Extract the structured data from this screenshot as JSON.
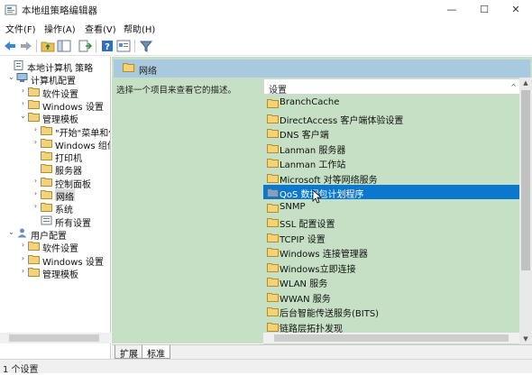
{
  "window": {
    "title": "本地组策略编辑器",
    "controls": {
      "minimize": "—",
      "maximize": "☐",
      "close": "✕"
    }
  },
  "menu": [
    "文件(F)",
    "操作(A)",
    "查看(V)",
    "帮助(H)"
  ],
  "toolbar": {
    "icons": [
      "back-arrow-icon",
      "forward-arrow-icon",
      "up-folder-icon",
      "show-hide-tree-icon",
      "export-list-icon",
      "help-icon",
      "properties-icon",
      "filter-icon"
    ]
  },
  "tree": {
    "items": [
      {
        "label": "本地计算机 策略",
        "expander": ""
      },
      {
        "label": "计算机配置",
        "expander": "v"
      },
      {
        "label": "软件设置",
        "expander": ">"
      },
      {
        "label": "Windows 设置",
        "expander": ">"
      },
      {
        "label": "管理模板",
        "expander": "v"
      },
      {
        "label": "\"开始\"菜单和任",
        "expander": ">"
      },
      {
        "label": "Windows 组件",
        "expander": ">"
      },
      {
        "label": "打印机",
        "expander": ""
      },
      {
        "label": "服务器",
        "expander": ""
      },
      {
        "label": "控制面板",
        "expander": ">"
      },
      {
        "label": "网络",
        "expander": ">"
      },
      {
        "label": "系统",
        "expander": ">"
      },
      {
        "label": "所有设置",
        "expander": ""
      },
      {
        "label": "用户配置",
        "expander": "v"
      },
      {
        "label": "软件设置",
        "expander": ">"
      },
      {
        "label": "Windows 设置",
        "expander": ">"
      },
      {
        "label": "管理模板",
        "expander": ">"
      }
    ]
  },
  "right": {
    "header": "网络",
    "description": "选择一个项目来查看它的描述。",
    "column_header": "设置",
    "items": [
      "BranchCache",
      "DirectAccess 客户端体验设置",
      "DNS 客户端",
      "Lanman 服务器",
      "Lanman 工作站",
      "Microsoft 对等网络服务",
      "QoS 数据包计划程序",
      "SNMP",
      "SSL 配置设置",
      "TCPIP 设置",
      "Windows 连接管理器",
      "Windows立即连接",
      "WLAN 服务",
      "WWAN 服务",
      "后台智能传送服务(BITS)",
      "链路层拓扑发现"
    ],
    "selected_index": 6
  },
  "tabs": [
    "扩展",
    "标准"
  ],
  "status": "1 个设置",
  "colors": {
    "pane_bg": "#c6e0c6",
    "header_bar": "#a9c9de",
    "selection": "#0b78d0",
    "folder": "#e8c15c"
  }
}
